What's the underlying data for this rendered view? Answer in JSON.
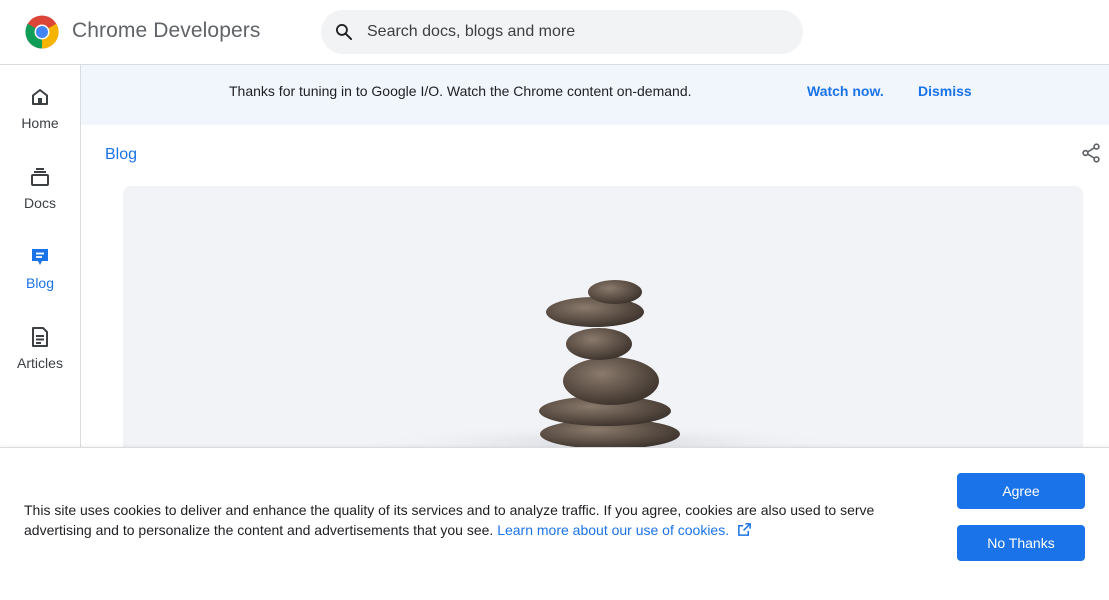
{
  "header": {
    "brand": "Chrome Developers",
    "search_placeholder": "Search docs, blogs and more"
  },
  "sidebar": {
    "items": [
      {
        "label": "Home",
        "icon": "home-icon",
        "active": false
      },
      {
        "label": "Docs",
        "icon": "docs-icon",
        "active": false
      },
      {
        "label": "Blog",
        "icon": "blog-icon",
        "active": true
      },
      {
        "label": "Articles",
        "icon": "articles-icon",
        "active": false
      }
    ]
  },
  "banner": {
    "text": "Thanks for tuning in to Google I/O. Watch the Chrome content on-demand.",
    "watch_label": "Watch now.",
    "dismiss_label": "Dismiss"
  },
  "main": {
    "breadcrumb": "Blog",
    "hero_image": "stacked-stones-image"
  },
  "cookie": {
    "text": "This site uses cookies to deliver and enhance the quality of its services and to analyze traffic. If you agree, cookies are also used to serve advertising and to personalize the content and advertisements that you see.",
    "link_label": "Learn more about our use of cookies.",
    "agree_label": "Agree",
    "no_thanks_label": "No Thanks"
  },
  "colors": {
    "accent": "#1a73e8",
    "banner_bg": "#f1f6fd",
    "hero_bg": "#f2f3f6"
  }
}
